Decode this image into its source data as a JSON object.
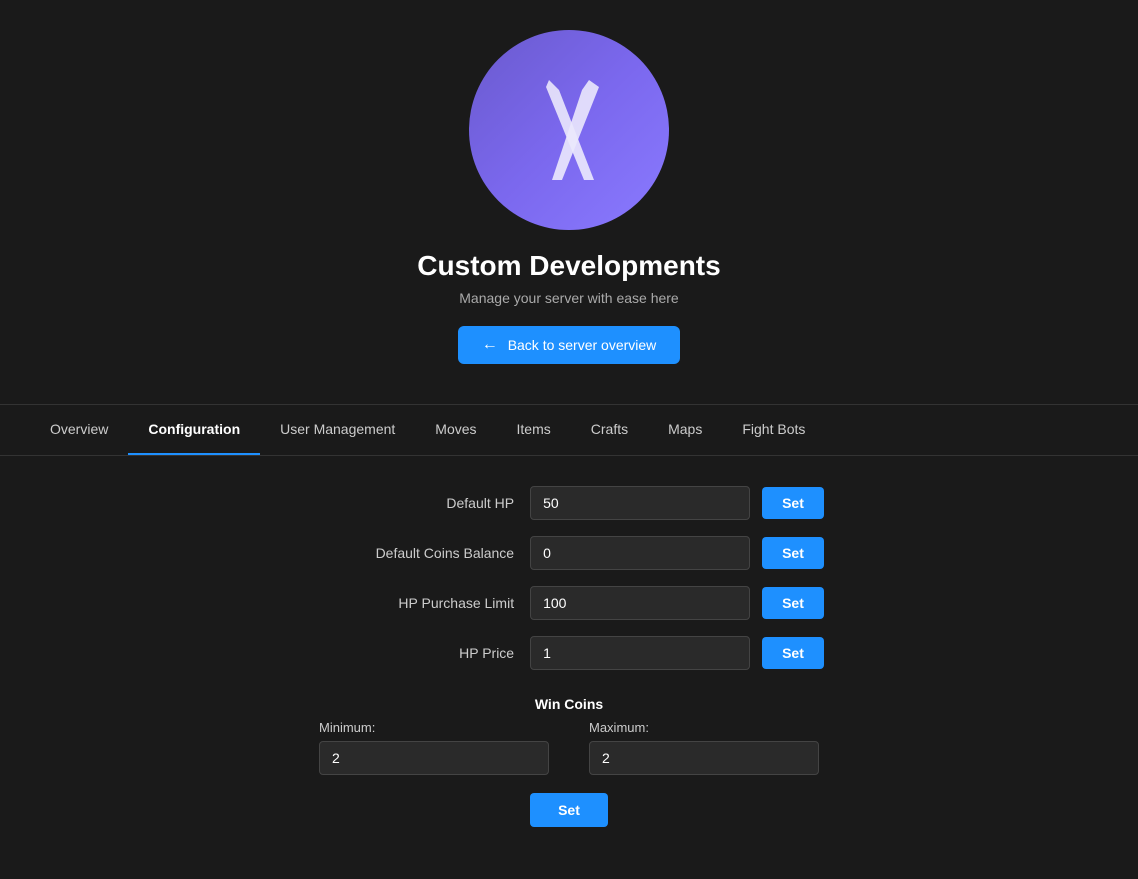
{
  "header": {
    "logo_alt": "Custom Developments Logo",
    "title": "Custom Developments",
    "subtitle": "Manage your server with ease here",
    "back_button_label": "Back to server overview"
  },
  "nav": {
    "tabs": [
      {
        "id": "overview",
        "label": "Overview",
        "active": false
      },
      {
        "id": "configuration",
        "label": "Configuration",
        "active": true
      },
      {
        "id": "user-management",
        "label": "User Management",
        "active": false
      },
      {
        "id": "moves",
        "label": "Moves",
        "active": false
      },
      {
        "id": "items",
        "label": "Items",
        "active": false
      },
      {
        "id": "crafts",
        "label": "Crafts",
        "active": false
      },
      {
        "id": "maps",
        "label": "Maps",
        "active": false
      },
      {
        "id": "fight-bots",
        "label": "Fight Bots",
        "active": false
      }
    ]
  },
  "config": {
    "default_hp": {
      "label": "Default HP",
      "value": "50",
      "button_label": "Set"
    },
    "default_coins_balance": {
      "label": "Default Coins Balance",
      "value": "0",
      "button_label": "Set"
    },
    "hp_purchase_limit": {
      "label": "HP Purchase Limit",
      "value": "100",
      "button_label": "Set"
    },
    "hp_price": {
      "label": "HP Price",
      "value": "1",
      "button_label": "Set"
    },
    "win_coins": {
      "title": "Win Coins",
      "minimum_label": "Minimum:",
      "maximum_label": "Maximum:",
      "minimum_value": "2",
      "maximum_value": "2",
      "button_label": "Set"
    }
  },
  "colors": {
    "accent": "#1e90ff",
    "bg": "#1a1a1a",
    "logo_gradient_start": "#6a5acd",
    "logo_gradient_end": "#8a7aff"
  }
}
